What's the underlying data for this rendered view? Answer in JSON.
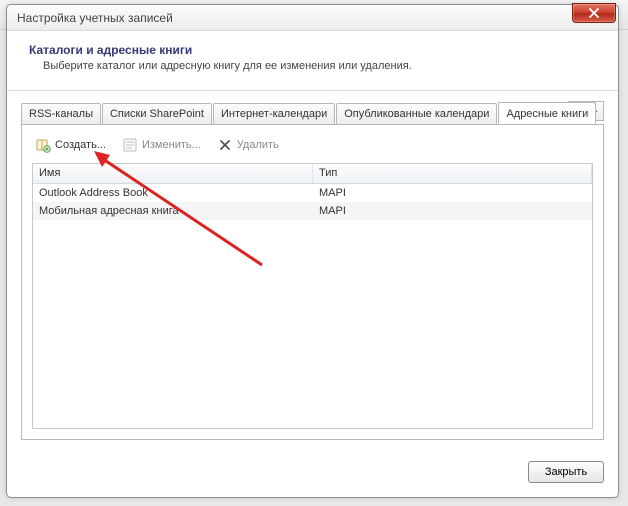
{
  "window": {
    "title": "Настройка учетных записей"
  },
  "header": {
    "title": "Каталоги и адресные книги",
    "subtitle": "Выберите каталог или адресную книгу для ее изменения или удаления."
  },
  "tabs": [
    {
      "label": "RSS-каналы",
      "active": false
    },
    {
      "label": "Списки SharePoint",
      "active": false
    },
    {
      "label": "Интернет-календари",
      "active": false
    },
    {
      "label": "Опубликованные календари",
      "active": false
    },
    {
      "label": "Адресные книги",
      "active": true
    }
  ],
  "toolbar": {
    "create_label": "Создать...",
    "edit_label": "Изменить...",
    "delete_label": "Удалить"
  },
  "list": {
    "columns": {
      "name": "Имя",
      "type": "Тип"
    },
    "rows": [
      {
        "name": "Outlook Address Book",
        "type": "MAPI"
      },
      {
        "name": "Мобильная адресная книга",
        "type": "MAPI"
      }
    ]
  },
  "footer": {
    "close_label": "Закрыть"
  },
  "colors": {
    "heading": "#333a75",
    "close_red": "#c8402d"
  }
}
